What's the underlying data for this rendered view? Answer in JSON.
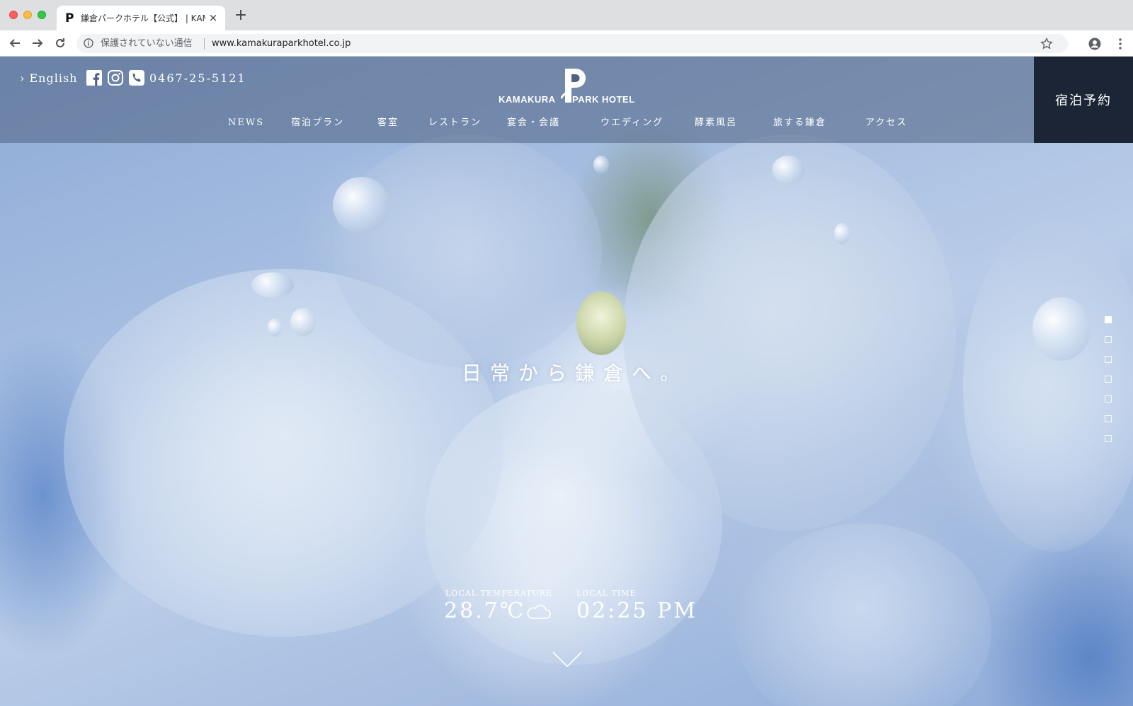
{
  "browser": {
    "tab": {
      "title": "鎌倉パークホテル【公式】 | KAMAKURA PARK HOTEL",
      "favicon_icon": "p-logo-icon"
    },
    "new_tab_label": "+",
    "close_label": "×",
    "address": {
      "security_text": "保護されていない通信",
      "url": "www.kamakuraparkhotel.co.jp"
    }
  },
  "header": {
    "english_link": "› English",
    "phone": "0467-25-5121",
    "logo": {
      "left_word": "KAMAKURA",
      "right_word": "PARK HOTEL",
      "mark": "P"
    },
    "reserve_label": "宿泊予約",
    "nav": [
      "NEWS",
      "宿泊プラン",
      "客室",
      "レストラン",
      "宴会・会議",
      "ウエディング",
      "酵素風呂",
      "旅する鎌倉",
      "アクセス"
    ]
  },
  "hero": {
    "tagline": "日常から鎌倉へ。"
  },
  "info": {
    "temperature_label": "LOCAL TEMPERATURE",
    "temperature_value": "28.7℃",
    "weather_icon": "cloud-icon",
    "time_label": "LOCAL TIME",
    "time_value": "02:25 PM"
  },
  "slides": {
    "count": 7,
    "active_index": 0
  },
  "colors": {
    "reserve_bg": "#1c2535",
    "header_overlay": "#4e6282",
    "text": "#ffffff"
  }
}
